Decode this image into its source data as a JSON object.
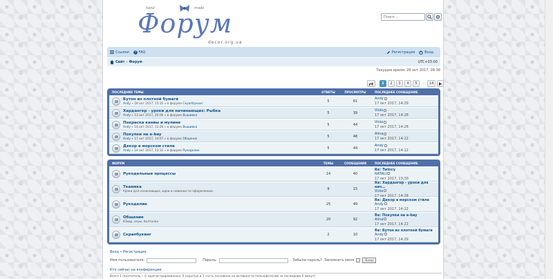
{
  "colors": {
    "accent": "#4f6fa8",
    "link": "#105289",
    "row": "#ecf3f7",
    "row_alt": "#e1ebf2",
    "nav": "#cfe0f0",
    "active_page": "#4692bf"
  },
  "header": {
    "logo_title": "Форум",
    "logo_hand": "hand",
    "logo_made": "made",
    "logo_site": "decor.org.ua",
    "search_placeholder": "Поиск…",
    "search_icon": "magnifier-icon",
    "settings_icon": "gear-icon"
  },
  "nav": {
    "links_label": "Ссылки",
    "faq_label": "FAQ",
    "register_label": "Регистрация",
    "login_label": "Вход",
    "breadcrumb_site": "Сайт",
    "breadcrumb_sep": "‹",
    "breadcrumb_forum": "Форум",
    "time_label": "UTC+03:00"
  },
  "current_time": "Текущее время: 26 окт 2017, 09:38",
  "pager": {
    "pages": [
      "1",
      "2",
      "3",
      "4",
      "5"
    ],
    "dots": "…",
    "last": "14"
  },
  "topics": {
    "headers": {
      "title": "Последние темы",
      "replies": "Ответы",
      "views": "Просмотры",
      "last": "Последнее сообщение"
    },
    "rows": [
      {
        "title": "Бутон из плотной бумаги",
        "author": "Andy",
        "date": "18 окт 2017, 15:35",
        "in": "в форуме",
        "forum": "Скрапбукинг",
        "replies": "5",
        "views": "61",
        "last_author": "Andy",
        "last_date": "17 окт 2017, 14:29"
      },
      {
        "title": "Хардангер - уроки для начинающих: Рыбка",
        "author": "Andy",
        "date": "13 окт 2017, 20:06",
        "in": "в форуме",
        "forum": "Вышивка",
        "replies": "5",
        "views": "39",
        "last_author": "Viola",
        "last_date": "17 окт 2017, 14:28"
      },
      {
        "title": "Покраска канвы и мулине",
        "author": "Andy",
        "date": "14 окт 2017, 12:26",
        "in": "в форуме",
        "forum": "Вышивка",
        "replies": "5",
        "views": "44",
        "last_author": "Viola",
        "last_date": "17 окт 2017, 14:26"
      },
      {
        "title": "Покупки на e-bay",
        "author": "Andy",
        "date": "17 окт 2017, 14:07",
        "in": "в форуме",
        "forum": "Общение",
        "replies": "5",
        "views": "48",
        "last_author": "Alina",
        "last_date": "17 окт 2017, 14:22"
      },
      {
        "title": "Декор в морском стиле",
        "author": "Andy",
        "date": "14 окт 2017, 13:12",
        "in": "в форуме",
        "forum": "Рукоделие",
        "replies": "5",
        "views": "44",
        "last_author": "Andy",
        "last_date": "17 окт 2017, 14:12"
      }
    ]
  },
  "forums": {
    "headers": {
      "title": "Форум",
      "topics": "Темы",
      "posts": "Сообщения",
      "last": "Последнее сообщение"
    },
    "rows": [
      {
        "title": "Рукодельные процессы",
        "desc": "",
        "topics": "14",
        "posts": "40",
        "last_title": "Re: Twincy",
        "last_author": "NATALI",
        "last_date": "17 окт 2017, 13:30"
      },
      {
        "title": "Ткаемка",
        "desc": "Уроки для начинающих, идеи и новинки по оформлению.",
        "topics": "9",
        "posts": "15",
        "last_title": "Re: Хардангер - уроки для нач…",
        "last_author": "Viola",
        "last_date": "17 окт 2017, 14:28"
      },
      {
        "title": "Рукоделие",
        "desc": "",
        "topics": "25",
        "posts": "49",
        "last_title": "Re: Декор в морском стиле",
        "last_author": "Andy",
        "last_date": "17 окт 2017, 14:12"
      },
      {
        "title": "Общение",
        "desc": "Юмор, игры, болталка",
        "topics": "20",
        "posts": "92",
        "last_title": "Re: Покупки на e-bay",
        "last_author": "Alina",
        "last_date": "17 окт 2017, 14:22"
      },
      {
        "title": "Скрапбукинг",
        "desc": "",
        "topics": "2",
        "posts": "10",
        "last_title": "Re: Бутон из плотной бумаги",
        "last_author": "Andy",
        "last_date": "17 окт 2017, 14:29"
      }
    ]
  },
  "login": {
    "title": "Вход • Регистрация",
    "user_label": "Имя пользователя:",
    "pass_label": "Пароль:",
    "forgot": "Забыли пароль?",
    "remember": "Запомнить меня",
    "button": "Вход"
  },
  "online": {
    "title": "Кто сейчас на конференции",
    "text": "Всего 1 посетитель :: 0 зарегистрированных, 0 скрытых и 1 гость (основано на активности пользователей за последние 5 минут)"
  }
}
